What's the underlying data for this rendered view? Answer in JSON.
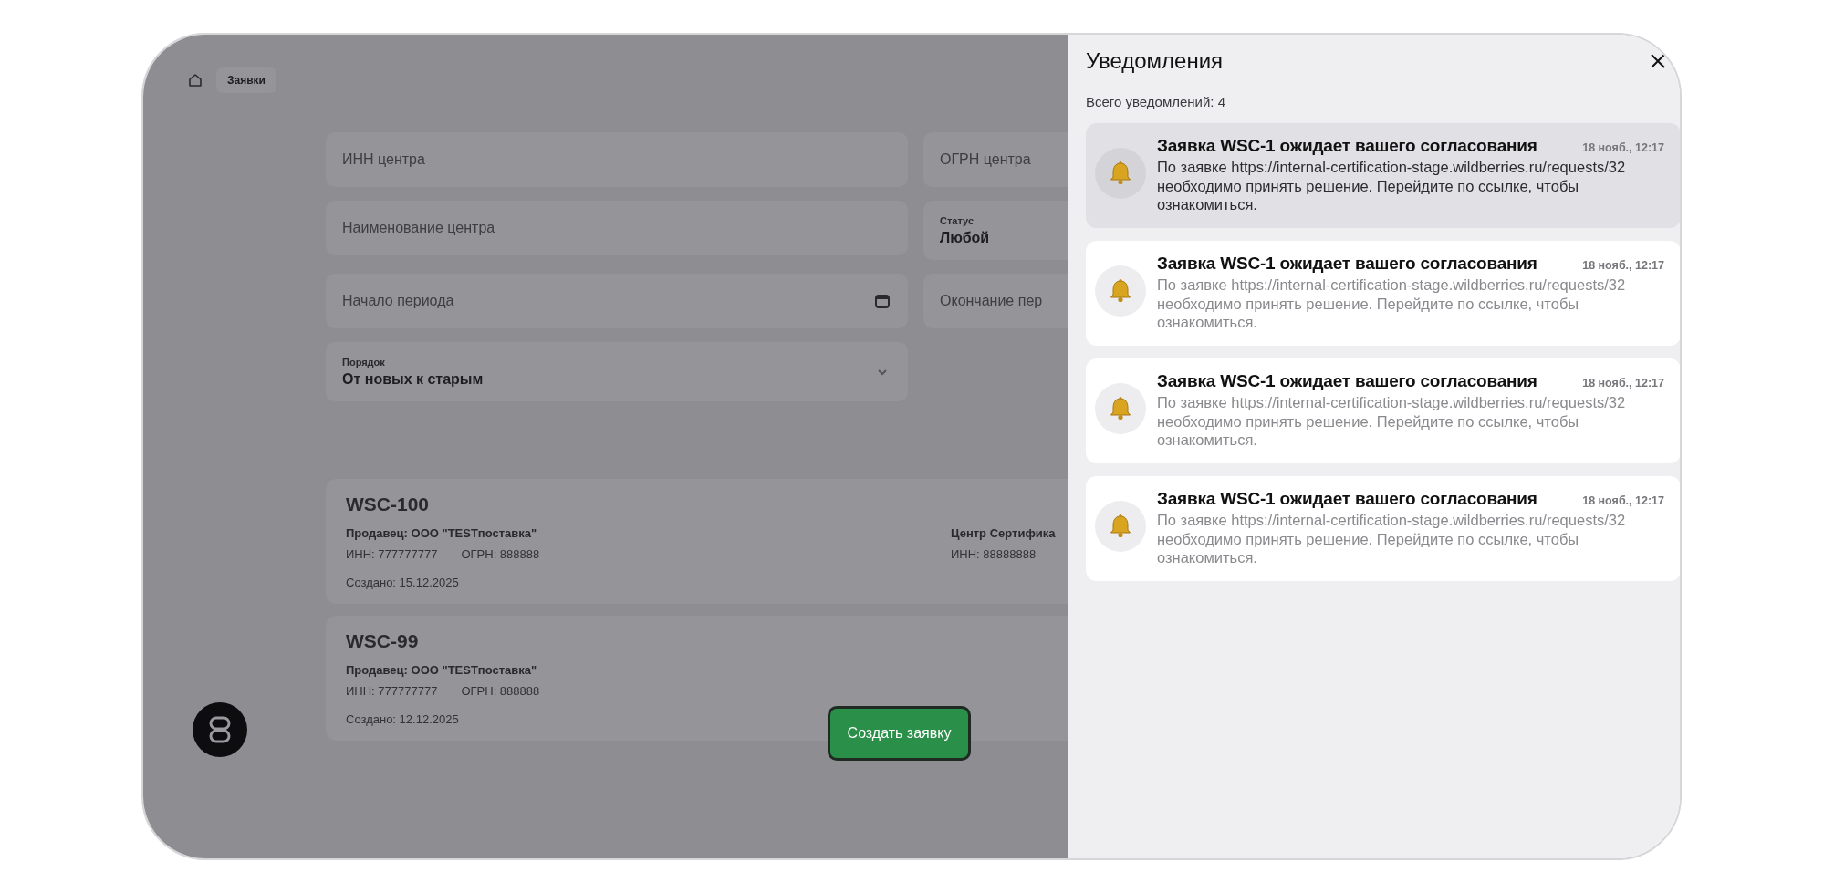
{
  "breadcrumb": {
    "label": "Заявки"
  },
  "filters": [
    {
      "kind": "input",
      "placeholder": "ИНН центра"
    },
    {
      "kind": "input",
      "placeholder": "ОГРН центра"
    },
    {
      "kind": "input",
      "placeholder": "Наименование центра"
    },
    {
      "kind": "select",
      "label": "Статус",
      "value": "Любой"
    },
    {
      "kind": "date",
      "placeholder": "Начало периода"
    },
    {
      "kind": "input",
      "placeholder": "Окончание пер"
    },
    {
      "kind": "select",
      "label": "Порядок",
      "value": "От новых к старым"
    }
  ],
  "requests": [
    {
      "id": "WSC-100",
      "seller": "Продавец: ООО \"TESTпоставка\"",
      "inn": "ИНН: 777777777",
      "ogrn": "ОГРН: 888888",
      "created": "Создано: 15.12.2025",
      "center": "Центр Сертифика",
      "center_inn": "ИНН: 88888888"
    },
    {
      "id": "WSC-99",
      "seller": "Продавец: ООО \"TESTпоставка\"",
      "inn": "ИНН: 777777777",
      "ogrn": "ОГРН: 888888",
      "created": "Создано: 12.12.2025"
    }
  ],
  "create_button": "Создать заявку",
  "notifications_panel": {
    "title": "Уведомления",
    "total": "Всего уведомлений: 4",
    "items": [
      {
        "title": "Заявка WSC-1 ожидает вашего согласования",
        "time": "18 нояб., 12:17",
        "body": "По заявке https://internal-certification-stage.wildberries.ru/requests/32 необходимо принять решение. Перейдите по ссылке, чтобы ознакомиться.",
        "unread": true
      },
      {
        "title": "Заявка WSC-1 ожидает вашего согласования",
        "time": "18 нояб., 12:17",
        "body": "По заявке https://internal-certification-stage.wildberries.ru/requests/32 необходимо принять решение. Перейдите по ссылке, чтобы ознакомиться.",
        "unread": false
      },
      {
        "title": "Заявка WSC-1 ожидает вашего согласования",
        "time": "18 нояб., 12:17",
        "body": "По заявке https://internal-certification-stage.wildberries.ru/requests/32 необходимо принять решение. Перейдите по ссылке, чтобы ознакомиться.",
        "unread": false
      },
      {
        "title": "Заявка WSC-1 ожидает вашего согласования",
        "time": "18 нояб., 12:17",
        "body": "По заявке https://internal-certification-stage.wildberries.ru/requests/32 необходимо принять решение. Перейдите по ссылке, чтобы ознакомиться.",
        "unread": false
      }
    ]
  }
}
